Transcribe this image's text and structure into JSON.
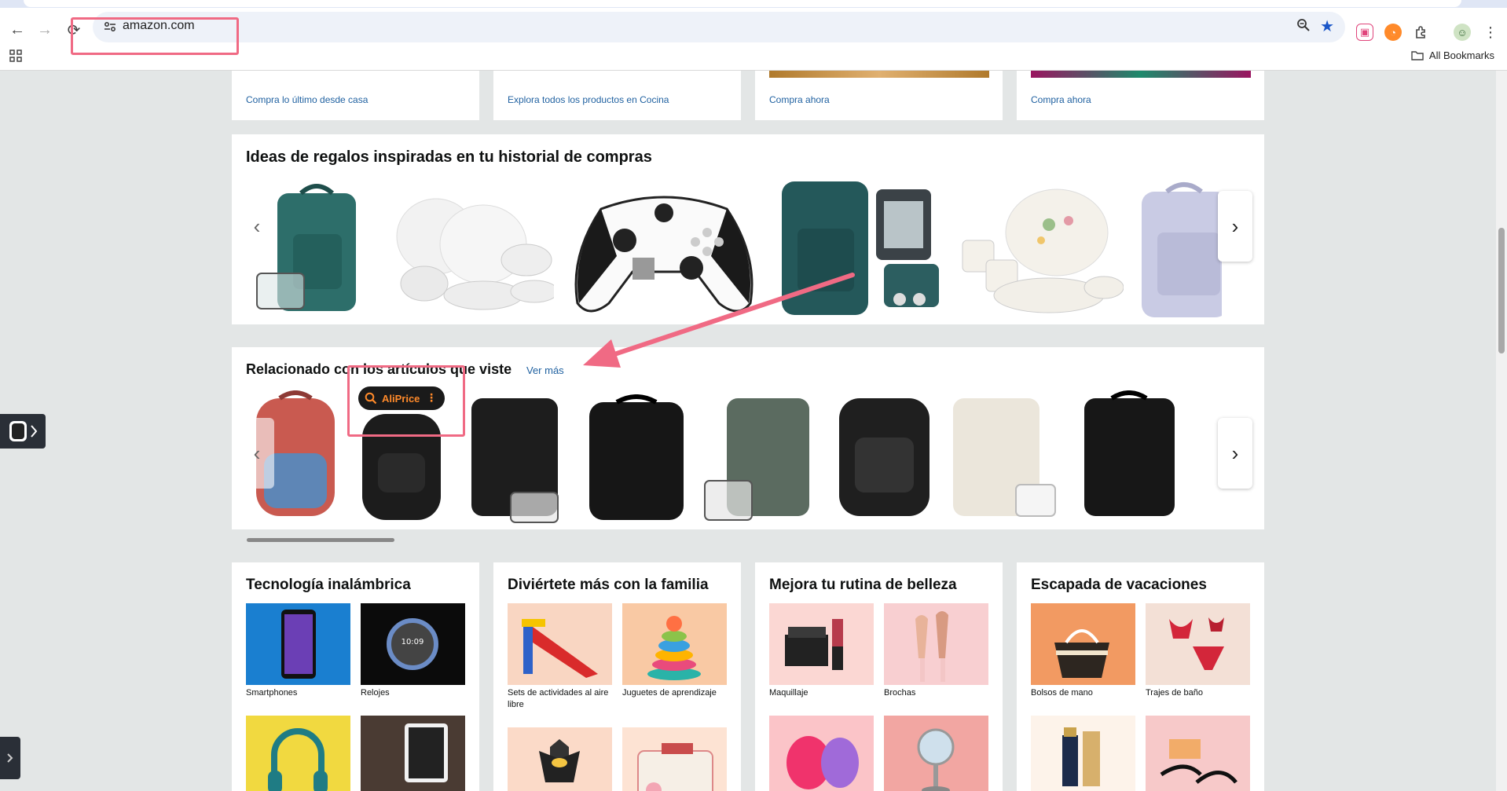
{
  "browser": {
    "url": "amazon.com",
    "bookmarks_label": "All Bookmarks",
    "back_glyph": "←",
    "forward_glyph": "→",
    "reload_glyph": "⟳"
  },
  "top_cards": [
    {
      "link": "Compra lo último desde casa"
    },
    {
      "link": "Explora todos los productos en Cocina"
    },
    {
      "link": "Compra ahora"
    },
    {
      "link": "Compra ahora"
    }
  ],
  "gift_ideas": {
    "title": "Ideas de regalos inspiradas en tu historial de compras"
  },
  "related": {
    "title": "Relacionado con los artículos que viste",
    "see_more": "Ver más"
  },
  "aliprice": {
    "label": "AliPrice",
    "more_glyph": "⋮"
  },
  "category_cards": [
    {
      "title": "Tecnología inalámbrica",
      "tiles": [
        {
          "label": "Smartphones"
        },
        {
          "label": "Relojes"
        },
        {
          "label": ""
        },
        {
          "label": ""
        }
      ]
    },
    {
      "title": "Diviértete más con la familia",
      "tiles": [
        {
          "label": "Sets de actividades al aire libre"
        },
        {
          "label": "Juguetes de aprendizaje"
        },
        {
          "label": ""
        },
        {
          "label": ""
        }
      ]
    },
    {
      "title": "Mejora tu rutina de belleza",
      "tiles": [
        {
          "label": "Maquillaje"
        },
        {
          "label": "Brochas"
        },
        {
          "label": ""
        },
        {
          "label": ""
        }
      ]
    },
    {
      "title": "Escapada de vacaciones",
      "tiles": [
        {
          "label": "Bolsos de mano"
        },
        {
          "label": "Trajes de baño"
        },
        {
          "label": ""
        },
        {
          "label": ""
        }
      ]
    }
  ],
  "watch_time": "10:09",
  "colors": {
    "link": "#2162a1",
    "annotation": "#f06a84",
    "aliprice_orange": "#ff8a2a",
    "star": "#1a56c8"
  }
}
